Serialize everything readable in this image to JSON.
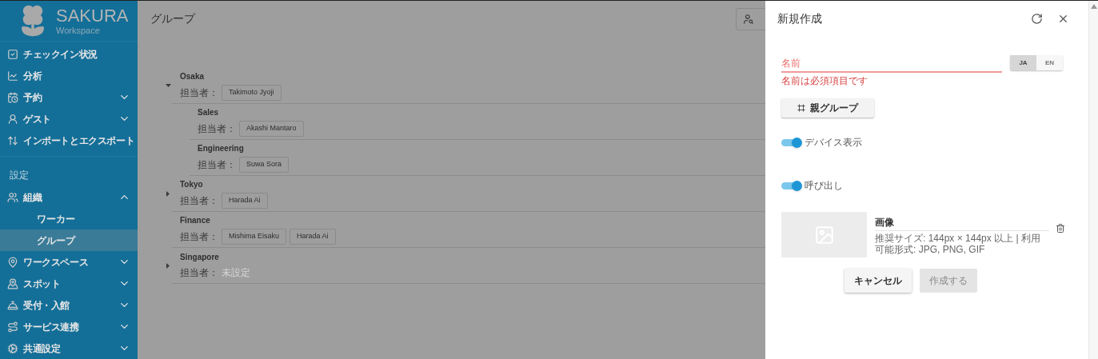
{
  "sidebar": {
    "logo": {
      "title": "SAKURA",
      "subtitle": "Workspace"
    },
    "items": [
      {
        "kind": "item",
        "label": "チェックイン状況"
      },
      {
        "kind": "item",
        "label": "分析"
      },
      {
        "kind": "item",
        "label": "予約",
        "expanded": false
      },
      {
        "kind": "item",
        "label": "ゲスト",
        "expanded": false
      },
      {
        "kind": "item",
        "label": "インポートとエクスポート"
      },
      {
        "kind": "section",
        "label": "設定"
      },
      {
        "kind": "item",
        "label": "組織",
        "expanded": true,
        "children": [
          {
            "label": "ワーカー",
            "selected": false
          },
          {
            "label": "グループ",
            "selected": true
          }
        ]
      },
      {
        "kind": "item",
        "label": "ワークスペース",
        "expanded": false
      },
      {
        "kind": "item",
        "label": "スポット",
        "expanded": false
      },
      {
        "kind": "item",
        "label": "受付・入館",
        "expanded": false
      },
      {
        "kind": "item",
        "label": "サービス連携",
        "expanded": false
      },
      {
        "kind": "item",
        "label": "共通設定",
        "expanded": false
      }
    ]
  },
  "main": {
    "title": "グループ",
    "groups": [
      {
        "name": "Osaka",
        "owner_label": "担当者：",
        "owners": [
          "Takimoto Jyoji"
        ],
        "expanded": true,
        "children": [
          {
            "name": "Sales",
            "owner_label": "担当者：",
            "owners": [
              "Akashi Mantaro"
            ]
          },
          {
            "name": "Engineering",
            "owner_label": "担当者：",
            "owners": [
              "Suwa Sora"
            ]
          }
        ]
      },
      {
        "name": "Tokyo",
        "owner_label": "担当者：",
        "owners": [
          "Harada Ai"
        ],
        "expanded": false
      },
      {
        "name": "Finance",
        "owner_label": "担当者：",
        "owners": [
          "Mishima Eisaku",
          "Harada Ai"
        ]
      },
      {
        "name": "Singapore",
        "owner_label": "担当者：",
        "owner_unset": "未設定",
        "expanded": false
      }
    ]
  },
  "panel": {
    "title": "新規作成",
    "name_field": {
      "placeholder": "名前",
      "error": "名前は必須項目です"
    },
    "languages": [
      {
        "label": "JA",
        "selected": true
      },
      {
        "label": "EN",
        "selected": false
      }
    ],
    "parent_button": "親グループ",
    "toggles": [
      {
        "label": "デバイス表示",
        "on": true
      },
      {
        "label": "呼び出し",
        "on": true
      }
    ],
    "image": {
      "label": "画像",
      "hint": "推奨サイズ: 144px × 144px 以上 | 利用可能形式: JPG, PNG, GIF"
    },
    "buttons": [
      {
        "label": "キャンセル",
        "disabled": false
      },
      {
        "label": "作成する",
        "disabled": true
      }
    ]
  }
}
